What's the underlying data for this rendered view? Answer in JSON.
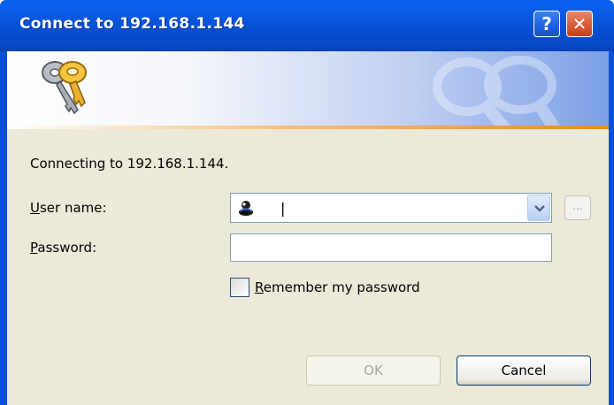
{
  "window": {
    "title": "Connect to 192.168.1.144",
    "help_label": "?",
    "close_label": "✕"
  },
  "dialog": {
    "message": "Connecting to 192.168.1.144.",
    "username_label_underlined": "U",
    "username_label_rest": "ser name:",
    "password_label_underlined": "P",
    "password_label_rest": "assword:",
    "username_value": "|",
    "password_value": "",
    "more_button_label": "...",
    "remember_label_underlined": "R",
    "remember_label_rest": "emember my password",
    "remember_checked": false,
    "ok_label": "OK",
    "cancel_label": "Cancel"
  },
  "colors": {
    "titlebar": "#0853d8",
    "dialog_background": "#ece9d8",
    "banner_accent": "#ef8a17"
  },
  "icons": [
    "keys-icon",
    "user-icon",
    "dropdown-arrow-icon"
  ]
}
